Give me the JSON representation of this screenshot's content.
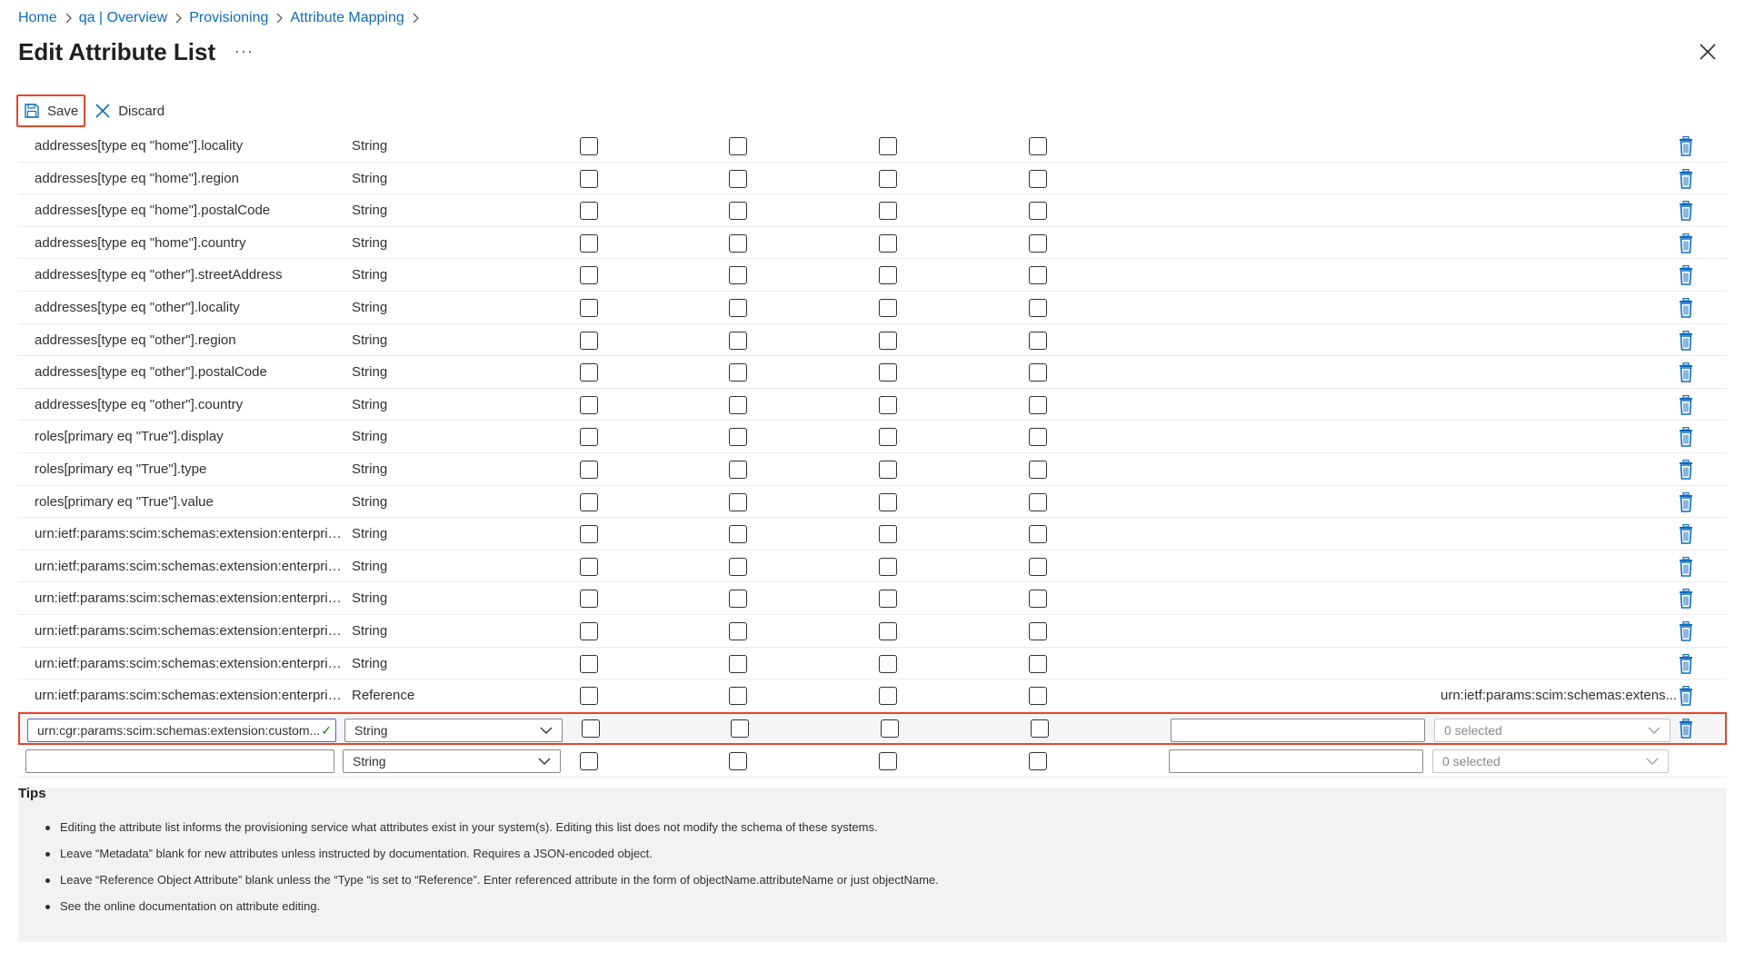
{
  "breadcrumb": [
    "Home",
    "qa | Overview",
    "Provisioning",
    "Attribute Mapping"
  ],
  "title": "Edit Attribute List",
  "more_label": "···",
  "toolbar": {
    "save_label": "Save",
    "discard_label": "Discard"
  },
  "rows": [
    {
      "name": "addresses[type eq \"home\"].locality",
      "type": "String",
      "ref": ""
    },
    {
      "name": "addresses[type eq \"home\"].region",
      "type": "String",
      "ref": ""
    },
    {
      "name": "addresses[type eq \"home\"].postalCode",
      "type": "String",
      "ref": ""
    },
    {
      "name": "addresses[type eq \"home\"].country",
      "type": "String",
      "ref": ""
    },
    {
      "name": "addresses[type eq \"other\"].streetAddress",
      "type": "String",
      "ref": ""
    },
    {
      "name": "addresses[type eq \"other\"].locality",
      "type": "String",
      "ref": ""
    },
    {
      "name": "addresses[type eq \"other\"].region",
      "type": "String",
      "ref": ""
    },
    {
      "name": "addresses[type eq \"other\"].postalCode",
      "type": "String",
      "ref": ""
    },
    {
      "name": "addresses[type eq \"other\"].country",
      "type": "String",
      "ref": ""
    },
    {
      "name": "roles[primary eq \"True\"].display",
      "type": "String",
      "ref": ""
    },
    {
      "name": "roles[primary eq \"True\"].type",
      "type": "String",
      "ref": ""
    },
    {
      "name": "roles[primary eq \"True\"].value",
      "type": "String",
      "ref": ""
    },
    {
      "name": "urn:ietf:params:scim:schemas:extension:enterpris...",
      "type": "String",
      "ref": ""
    },
    {
      "name": "urn:ietf:params:scim:schemas:extension:enterpris...",
      "type": "String",
      "ref": ""
    },
    {
      "name": "urn:ietf:params:scim:schemas:extension:enterpris...",
      "type": "String",
      "ref": ""
    },
    {
      "name": "urn:ietf:params:scim:schemas:extension:enterpris...",
      "type": "String",
      "ref": ""
    },
    {
      "name": "urn:ietf:params:scim:schemas:extension:enterpris...",
      "type": "String",
      "ref": ""
    },
    {
      "name": "urn:ietf:params:scim:schemas:extension:enterpris...",
      "type": "Reference",
      "ref": "urn:ietf:params:scim:schemas:extens..."
    }
  ],
  "edit_row": {
    "name_value": "urn:cgr:params:scim:schemas:extension:custom...",
    "type_value": "String",
    "metadata_value": "",
    "ref_value": "0 selected"
  },
  "new_row": {
    "name_value": "",
    "type_value": "String",
    "metadata_value": "",
    "ref_value": "0 selected"
  },
  "tips": {
    "heading": "Tips",
    "items": [
      "Editing the attribute list informs the provisioning service what attributes exist in your system(s). Editing this list does not modify the schema of these systems.",
      "Leave “Metadata” blank for new attributes unless instructed by documentation. Requires a JSON-encoded object.",
      "Leave “Reference Object Attribute” blank unless the “Type “is set to “Reference”. Enter referenced attribute in the form of objectName.attributeName or just objectName.",
      "See the online documentation on attribute editing."
    ]
  },
  "colors": {
    "link": "#0f6cbd",
    "highlight_border": "#e8452c",
    "delete_icon": "#0f6cbd"
  }
}
